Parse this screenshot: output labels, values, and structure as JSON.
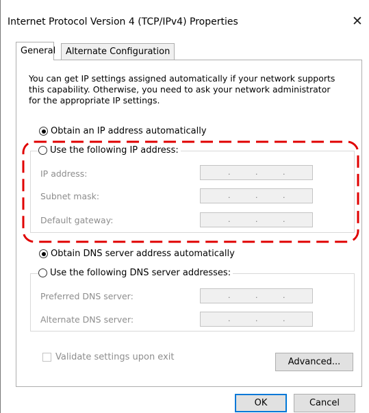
{
  "window": {
    "title": "Internet Protocol Version 4 (TCP/IPv4) Properties",
    "close_glyph": "✕"
  },
  "tabs": [
    {
      "label": "General",
      "active": true
    },
    {
      "label": "Alternate Configuration",
      "active": false
    }
  ],
  "description": {
    "line1": "You can get IP settings assigned automatically if your network supports",
    "line2": "this capability. Otherwise, you need to ask your network administrator",
    "line3": "for the appropriate IP settings."
  },
  "ip_section": {
    "auto_label": "Obtain an IP address automatically",
    "auto_selected": true,
    "manual_label": "Use the following IP address:",
    "manual_selected": false,
    "fields": [
      {
        "label": "IP address:",
        "value": ". . ."
      },
      {
        "label": "Subnet mask:",
        "value": ". . ."
      },
      {
        "label": "Default gateway:",
        "value": ". . ."
      }
    ]
  },
  "dns_section": {
    "auto_label": "Obtain DNS server address automatically",
    "auto_selected": true,
    "manual_label": "Use the following DNS server addresses:",
    "manual_selected": false,
    "fields": [
      {
        "label": "Preferred DNS server:",
        "value": ". . ."
      },
      {
        "label": "Alternate DNS server:",
        "value": ". . ."
      }
    ]
  },
  "validate": {
    "label": "Validate settings upon exit",
    "checked": false
  },
  "buttons": {
    "advanced": "Advanced...",
    "ok": "OK",
    "cancel": "Cancel"
  },
  "colors": {
    "highlight_border": "#e00000",
    "accent": "#0078d7",
    "disabled_text": "#8d8d8d"
  }
}
